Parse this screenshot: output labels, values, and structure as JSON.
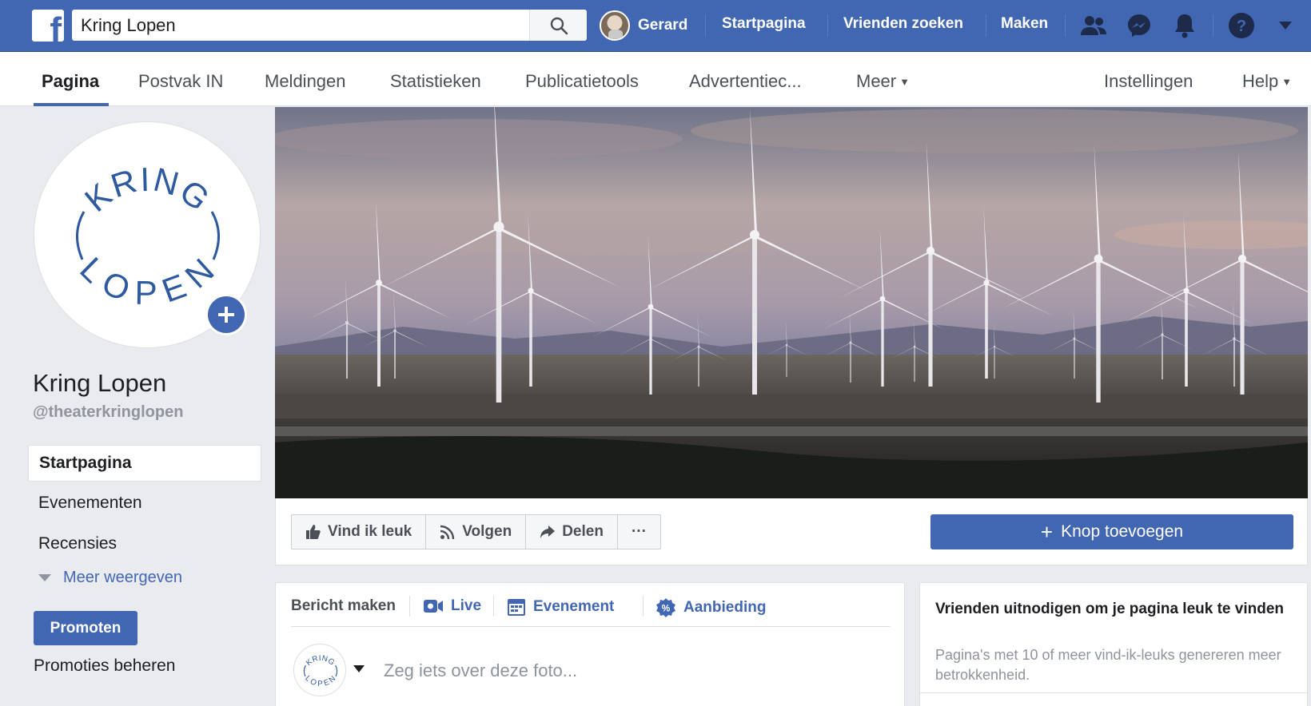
{
  "topbar": {
    "search_value": "Kring Lopen",
    "user_name": "Gerard",
    "links": [
      "Startpagina",
      "Vrienden zoeken",
      "Maken"
    ]
  },
  "tabs": {
    "items": [
      "Pagina",
      "Postvak IN",
      "Meldingen",
      "Statistieken",
      "Publicatietools",
      "Advertentiec...",
      "Meer"
    ],
    "right": [
      "Instellingen",
      "Help"
    ]
  },
  "page": {
    "name": "Kring Lopen",
    "handle": "@theaterkringlopen",
    "logo_top": "KRING",
    "logo_bottom": "LOPEN"
  },
  "sidebar": {
    "items": [
      "Startpagina",
      "Evenementen",
      "Recensies"
    ],
    "more": "Meer weergeven",
    "promote": "Promoten",
    "manage_promotions": "Promoties beheren"
  },
  "actions": {
    "like": "Vind ik leuk",
    "follow": "Volgen",
    "share": "Delen",
    "more": "···",
    "add_button": "Knop toevoegen"
  },
  "composer": {
    "tabs": [
      "Bericht maken",
      "Live",
      "Evenement",
      "Aanbieding"
    ],
    "placeholder": "Zeg iets over deze foto..."
  },
  "invite": {
    "title": "Vrienden uitnodigen om je pagina leuk te vinden",
    "subtitle": "Pagina's met 10 of meer vind-ik-leuks genereren meer betrokkenheid."
  },
  "colors": {
    "brand_blue": "#4267b2",
    "link_blue": "#4267b2",
    "page_bg": "#e9ebee"
  }
}
